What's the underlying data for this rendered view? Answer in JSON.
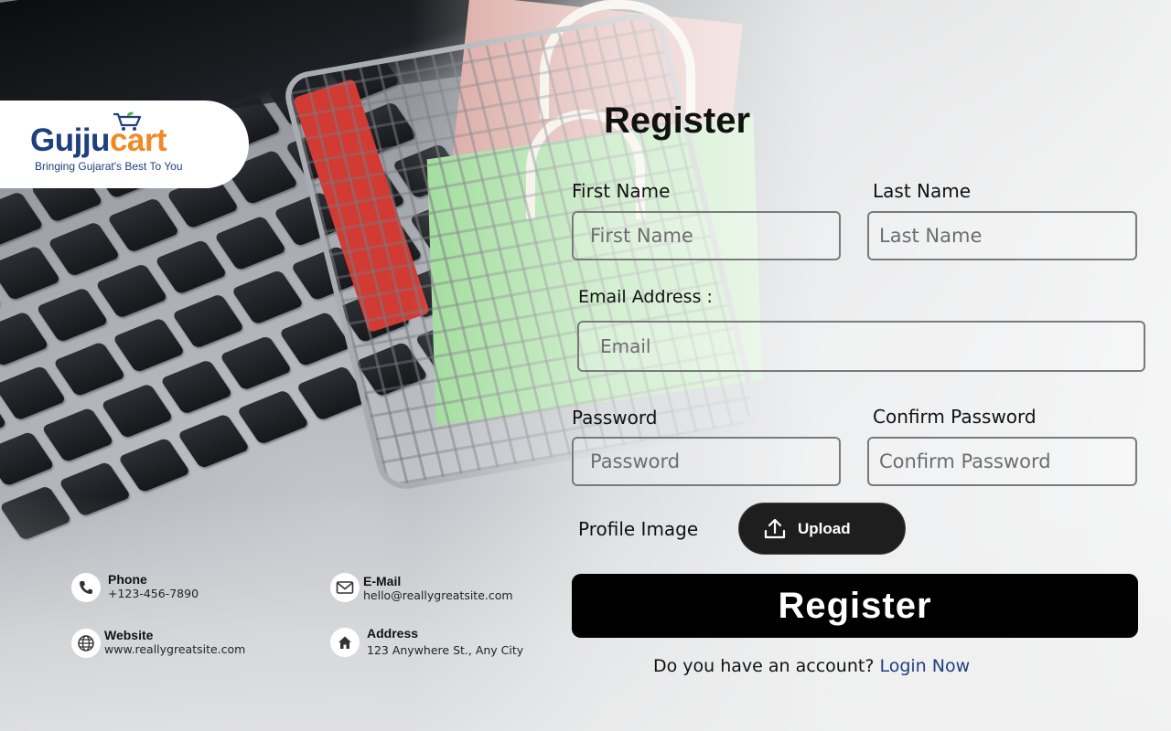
{
  "brand": {
    "name_part1": "Gujju",
    "name_part2": "cart",
    "tagline": "Bringing Gujarat's Best To You",
    "color_primary": "#1f3f7f",
    "color_accent": "#f08a24"
  },
  "form": {
    "title": "Register",
    "first_name": {
      "label": "First Name",
      "placeholder": "First Name",
      "value": ""
    },
    "last_name": {
      "label": "Last Name",
      "placeholder": "Last Name",
      "value": ""
    },
    "email": {
      "label": "Email Address  :",
      "placeholder": "Email",
      "value": ""
    },
    "password": {
      "label": "Password",
      "placeholder": "Password",
      "value": ""
    },
    "confirm_password": {
      "label": "Confirm Password",
      "placeholder": "Confirm Password",
      "value": ""
    },
    "profile_image": {
      "label": "Profile Image",
      "button_label": "Upload",
      "icon": "upload-icon"
    },
    "submit_label": "Register",
    "login_prompt": "Do you have an account?",
    "login_link": "Login Now"
  },
  "contacts": {
    "phone": {
      "title": "Phone",
      "value": "+123-456-7890",
      "icon": "phone-icon"
    },
    "email": {
      "title": "E-Mail",
      "value": "hello@reallygreatsite.com",
      "icon": "mail-icon"
    },
    "website": {
      "title": "Website",
      "value": "www.reallygreatsite.com",
      "icon": "globe-icon"
    },
    "address": {
      "title": "Address",
      "value": "123 Anywhere St., Any City",
      "icon": "home-icon"
    }
  }
}
